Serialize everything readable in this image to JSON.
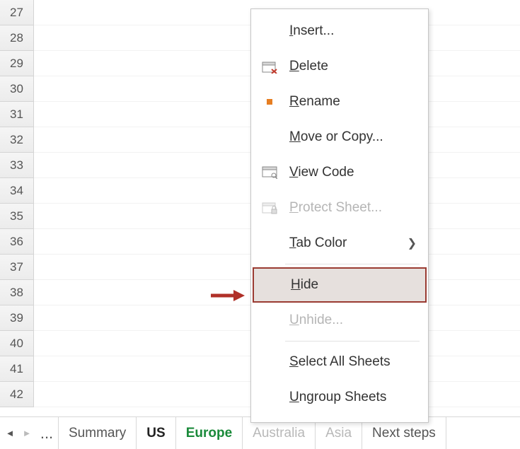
{
  "rows": [
    "27",
    "28",
    "29",
    "30",
    "31",
    "32",
    "33",
    "34",
    "35",
    "36",
    "37",
    "38",
    "39",
    "40",
    "41",
    "42"
  ],
  "tabs": {
    "ellipsis": "...",
    "items": [
      {
        "label": "Summary",
        "state": "normal"
      },
      {
        "label": "US",
        "state": "selected-bold"
      },
      {
        "label": "Europe",
        "state": "selected-green"
      },
      {
        "label": "Australia",
        "state": "covered"
      },
      {
        "label": "Asia",
        "state": "covered"
      },
      {
        "label": "Next steps",
        "state": "normal"
      }
    ]
  },
  "menu": {
    "insert": "nsert...",
    "delete": "elete",
    "rename": "ename",
    "move": "ove or Copy...",
    "viewcode": "iew Code",
    "protect": "rotect Sheet...",
    "tabcolor": "ab Color",
    "hide": "ide",
    "unhide": "nhide...",
    "selectall": "elect All Sheets",
    "ungroup": "ngroup Sheets",
    "keys": {
      "insert": "I",
      "delete": "D",
      "rename": "R",
      "move": "M",
      "viewcode": "V",
      "protect": "P",
      "tabcolor": "T",
      "hide": "H",
      "unhide": "U",
      "selectall": "S",
      "ungroup": "U"
    }
  }
}
